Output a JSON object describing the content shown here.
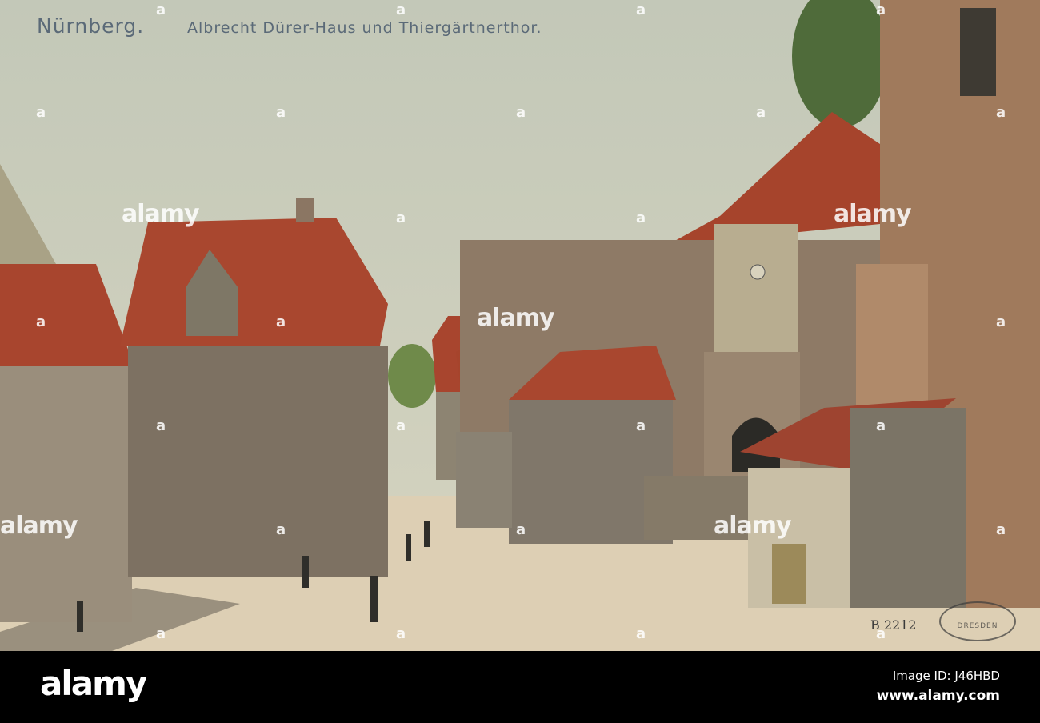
{
  "postcard": {
    "city": "Nürnberg.",
    "subtitle": "Albrecht Dürer-Haus und Thiergärtnerthor.",
    "plate_number": "B 2212",
    "stamp_text": "DRESDEN"
  },
  "watermark": {
    "text": "alamy",
    "mark": "a"
  },
  "footer": {
    "logo": "alamy",
    "image_id": "Image ID: J46HBD",
    "site": "www.alamy.com"
  },
  "colors": {
    "sky": "#c9cdbd",
    "roof": "#a8452e",
    "wall": "#8a7a68",
    "street": "#ddcfb4",
    "caption": "#5b6a78"
  }
}
